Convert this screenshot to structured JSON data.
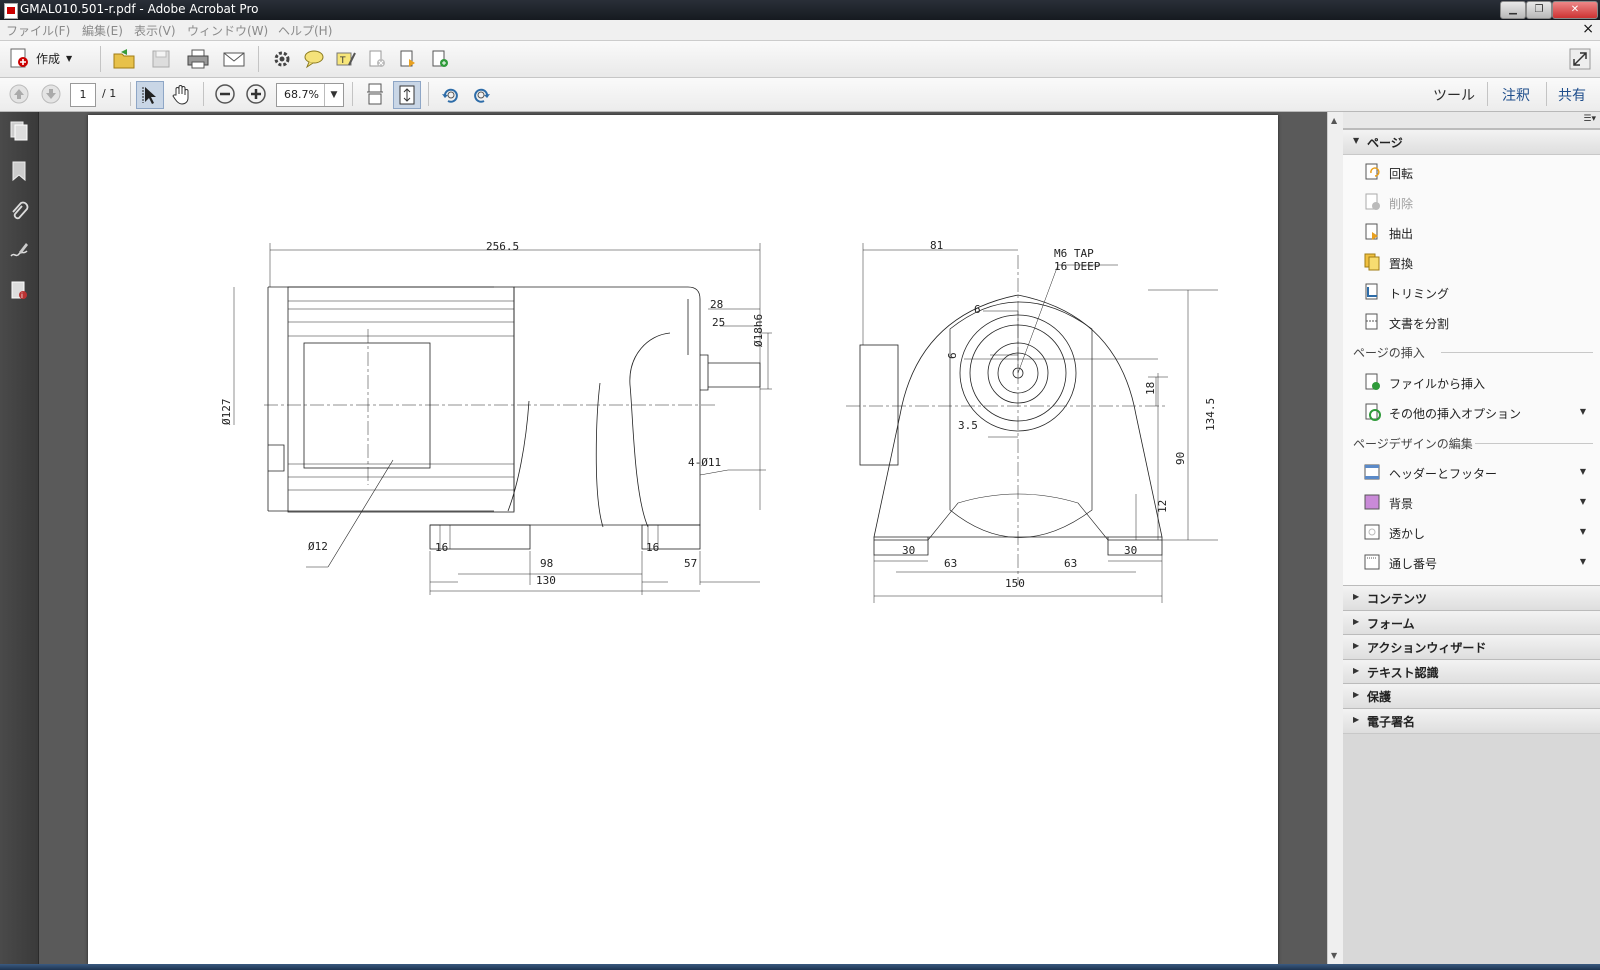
{
  "window": {
    "title": "GMAL010.501-r.pdf - Adobe Acrobat Pro",
    "min_label": "▁",
    "restore_label": "❐",
    "close_label": "✕"
  },
  "menu": {
    "items": [
      "ファイル(F)",
      "編集(E)",
      "表示(V)",
      "ウィンドウ(W)",
      "ヘルプ(H)"
    ],
    "close_doc": "×"
  },
  "toolbar": {
    "create_label": "作成"
  },
  "nav": {
    "page_current": "1",
    "page_total": "/ 1",
    "zoom": "68.7%"
  },
  "right_tabs": {
    "tools": "ツール",
    "comment": "注釈",
    "share": "共有"
  },
  "panel": {
    "pages_header": "ページ",
    "pages_items": [
      {
        "label": "回転",
        "icon": "rotate-page-icon",
        "disabled": false
      },
      {
        "label": "削除",
        "icon": "delete-page-icon",
        "disabled": true
      },
      {
        "label": "抽出",
        "icon": "extract-page-icon",
        "disabled": false
      },
      {
        "label": "置換",
        "icon": "replace-page-icon",
        "disabled": false
      },
      {
        "label": "トリミング",
        "icon": "crop-icon",
        "disabled": false
      },
      {
        "label": "文書を分割",
        "icon": "split-doc-icon",
        "disabled": false
      }
    ],
    "insert_header": "ページの挿入",
    "insert_items": [
      {
        "label": "ファイルから挿入",
        "icon": "insert-file-icon",
        "dropdown": false
      },
      {
        "label": "その他の挿入オプション",
        "icon": "insert-options-icon",
        "dropdown": true
      }
    ],
    "design_header": "ページデザインの編集",
    "design_items": [
      {
        "label": "ヘッダーとフッター",
        "icon": "header-footer-icon",
        "dropdown": true
      },
      {
        "label": "背景",
        "icon": "background-icon",
        "dropdown": true
      },
      {
        "label": "透かし",
        "icon": "watermark-icon",
        "dropdown": true
      },
      {
        "label": "通し番号",
        "icon": "bates-number-icon",
        "dropdown": true
      }
    ],
    "collapsed_sections": [
      "コンテンツ",
      "フォーム",
      "アクションウィザード",
      "テキスト認識",
      "保護",
      "電子署名"
    ]
  },
  "drawing": {
    "side_dims": [
      "256.5",
      "28",
      "25",
      "Ø18h6",
      "Ø127",
      "4-Ø11",
      "Ø12",
      "16",
      "98",
      "16",
      "57",
      "130"
    ],
    "front_dims": [
      "81",
      "M6 TAP",
      "16 DEEP",
      "6",
      "6",
      "18",
      "134.5",
      "3.5",
      "90",
      "12",
      "30",
      "63",
      "63",
      "30",
      "150"
    ]
  }
}
